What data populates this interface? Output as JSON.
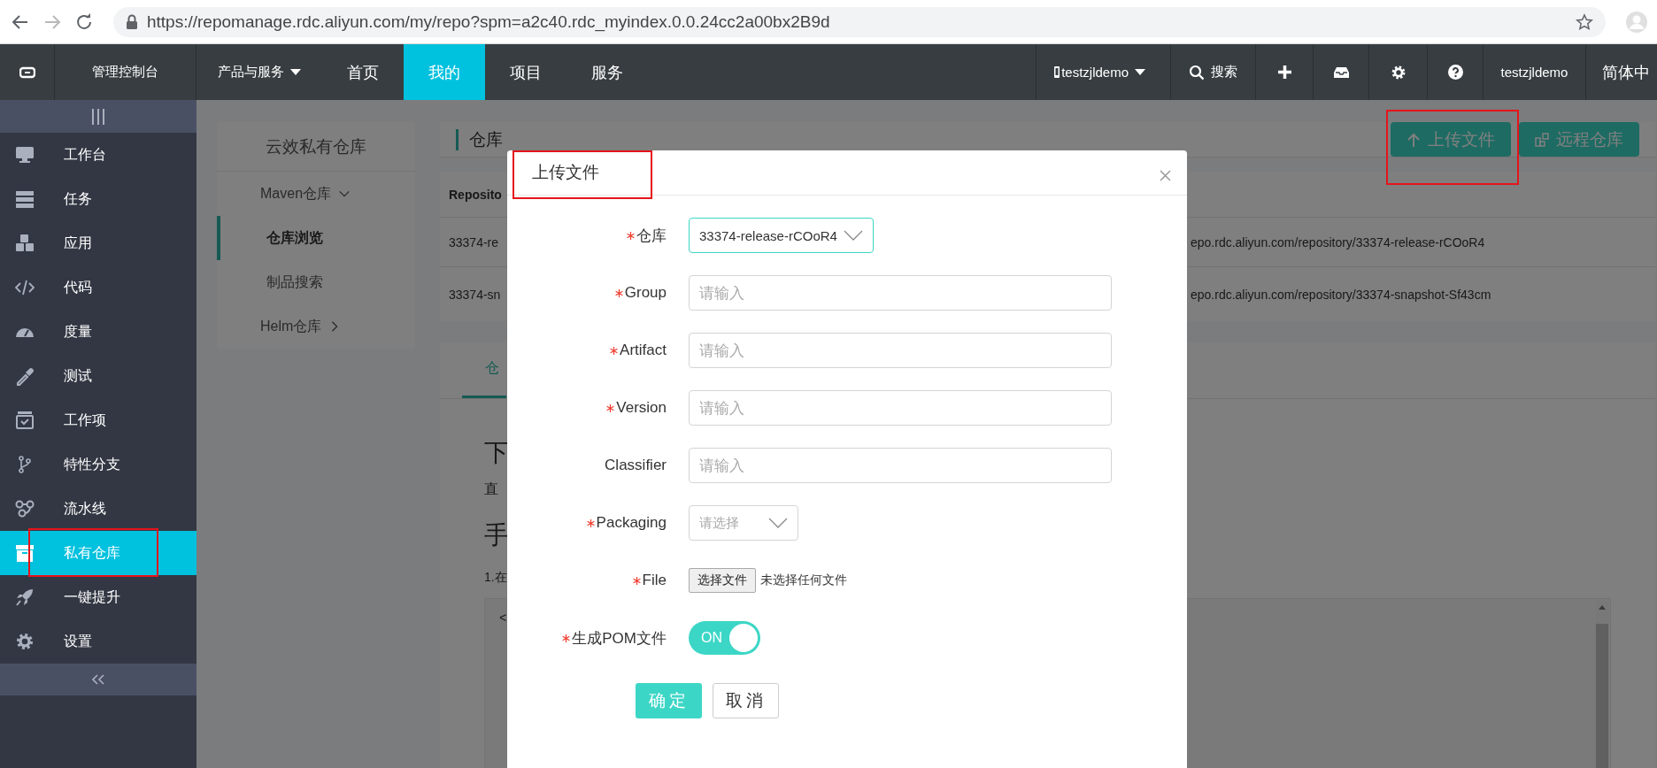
{
  "browser": {
    "url": "https://repomanage.rdc.aliyun.com/my/repo?spm=a2c40.rdc_myindex.0.0.24cc2a00bx2B9d"
  },
  "topnav": {
    "console": "管理控制台",
    "menu": [
      {
        "label": "产品与服务",
        "kind": "dropdown",
        "selected": false
      },
      {
        "label": "首页",
        "kind": "link",
        "selected": false
      },
      {
        "label": "我的",
        "kind": "link",
        "selected": true
      },
      {
        "label": "项目",
        "kind": "link",
        "selected": false
      },
      {
        "label": "服务",
        "kind": "link",
        "selected": false
      }
    ],
    "right": [
      {
        "kind": "account",
        "label": "testzjldemo"
      },
      {
        "kind": "search",
        "label": "搜索"
      },
      {
        "kind": "add"
      },
      {
        "kind": "inbox"
      },
      {
        "kind": "settings"
      },
      {
        "kind": "help"
      },
      {
        "kind": "user",
        "label": "testzjldemo"
      },
      {
        "kind": "language",
        "label": "简体中"
      }
    ]
  },
  "sidebar": {
    "items": [
      {
        "label": "工作台",
        "selected": false,
        "highlighted": false
      },
      {
        "label": "任务",
        "selected": false,
        "highlighted": false
      },
      {
        "label": "应用",
        "selected": false,
        "highlighted": false
      },
      {
        "label": "代码",
        "selected": false,
        "highlighted": false
      },
      {
        "label": "度量",
        "selected": false,
        "highlighted": false
      },
      {
        "label": "测试",
        "selected": false,
        "highlighted": false
      },
      {
        "label": "工作项",
        "selected": false,
        "highlighted": false
      },
      {
        "label": "特性分支",
        "selected": false,
        "highlighted": false
      },
      {
        "label": "流水线",
        "selected": false,
        "highlighted": false
      },
      {
        "label": "私有仓库",
        "selected": true,
        "highlighted": true
      },
      {
        "label": "一键提升",
        "selected": false,
        "highlighted": false
      },
      {
        "label": "设置",
        "selected": false,
        "highlighted": false
      }
    ]
  },
  "repo_nav": {
    "title": "云效私有仓库",
    "items": [
      {
        "label": "Maven仓库",
        "kind": "group",
        "expanded": true
      },
      {
        "label": "仓库浏览",
        "kind": "link",
        "selected": true
      },
      {
        "label": "制品搜索",
        "kind": "link",
        "selected": false
      },
      {
        "label": "Helm仓库",
        "kind": "group",
        "expanded": false
      }
    ]
  },
  "content": {
    "title": "仓库",
    "buttons": [
      {
        "label": "上传文件",
        "kind": "upload",
        "highlighted": true
      },
      {
        "label": "远程仓库",
        "kind": "remote",
        "highlighted": false
      }
    ],
    "table": {
      "columns": [
        "Reposito"
      ],
      "rows": [
        [
          "33374-re",
          "epo.rdc.aliyun.com/repository/33374-release-rCOoR4"
        ],
        [
          "33374-sn",
          "epo.rdc.aliyun.com/repository/33374-snapshot-Sf43cm"
        ]
      ]
    },
    "guide": {
      "tabs": [
        {
          "label": "仓",
          "selected": true
        }
      ],
      "heading_1": "下",
      "text_1": "直",
      "heading_2": "手",
      "step": "1.在",
      "code": "<"
    }
  },
  "dialog": {
    "title": "上传文件",
    "title_highlighted": true,
    "fields": [
      {
        "label": "仓库",
        "required": true,
        "kind": "select",
        "value": "33374-release-rCOoR4",
        "focused": true
      },
      {
        "label": "Group",
        "required": true,
        "kind": "input",
        "placeholder": "请输入",
        "focused": false
      },
      {
        "label": "Artifact",
        "required": true,
        "kind": "input",
        "placeholder": "请输入",
        "focused": false
      },
      {
        "label": "Version",
        "required": true,
        "kind": "input",
        "placeholder": "请输入",
        "focused": false
      },
      {
        "label": "Classifier",
        "required": false,
        "kind": "input",
        "placeholder": "请输入",
        "focused": false
      },
      {
        "label": "Packaging",
        "required": true,
        "kind": "select",
        "placeholder": "请选择",
        "focused": false
      },
      {
        "label": "File",
        "required": true,
        "kind": "file",
        "button": "选择文件",
        "status": "未选择任何文件"
      },
      {
        "label": "生成POM文件",
        "required": true,
        "kind": "switch",
        "on": true,
        "text": "ON"
      }
    ],
    "buttons": [
      {
        "label": "确定",
        "kind": "primary"
      },
      {
        "label": "取消",
        "kind": "secondary"
      }
    ]
  }
}
